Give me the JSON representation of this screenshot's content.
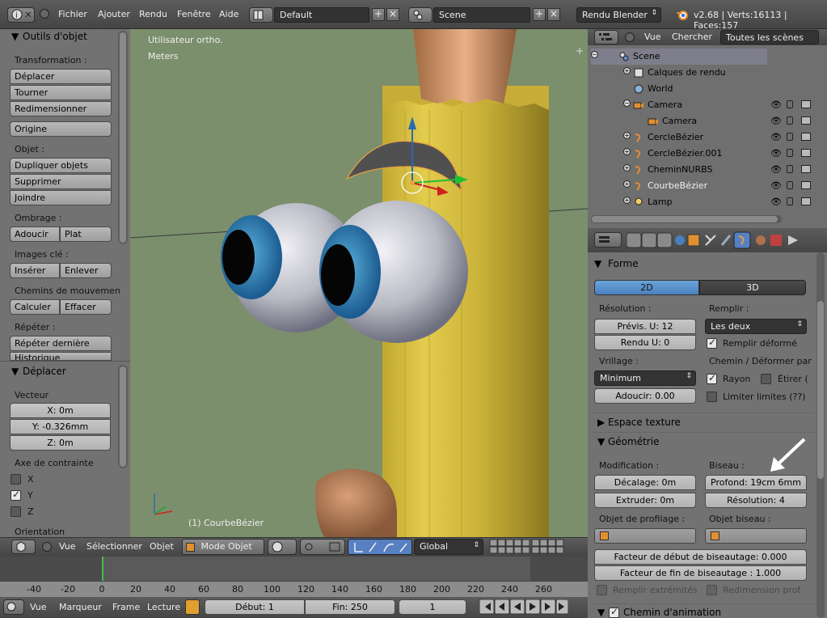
{
  "topbar": {
    "menus": [
      "Fichier",
      "Ajouter",
      "Rendu",
      "Fenêtre",
      "Aide"
    ],
    "layout": "Default",
    "scene": "Scene",
    "engine": "Rendu Blender",
    "stats": "v2.68 | Verts:16113 | Faces:157"
  },
  "toolshelf": {
    "title": "Outils d'objet",
    "transform_label": "Transformation :",
    "move": "Déplacer",
    "rotate": "Tourner",
    "scale": "Redimensionner",
    "origin": "Origine",
    "object_label": "Objet :",
    "duplicate": "Dupliquer objets",
    "delete": "Supprimer",
    "join": "Joindre",
    "shading_label": "Ombrage :",
    "smooth": "Adoucir",
    "flat": "Plat",
    "keyframes_label": "Images clé :",
    "insert": "Insérer",
    "remove": "Enlever",
    "motion_label": "Chemins de mouvemen",
    "calculate": "Calculer",
    "clear": "Effacer",
    "repeat_label": "Répéter :",
    "repeat_last": "Répéter dernière",
    "history": "Historique"
  },
  "operator": {
    "title": "Déplacer",
    "vector_label": "Vecteur",
    "x": "X: 0m",
    "y": "Y: -0.326mm",
    "z": "Z: 0m",
    "constraint_label": "Axe de contrainte",
    "axis_x": "X",
    "axis_y": "Y",
    "axis_z": "Z",
    "orientation": "Orientation"
  },
  "viewport": {
    "view_name": "Utilisateur ortho.",
    "units": "Meters",
    "object_label": "(1) CourbeBézier"
  },
  "viewport_header": {
    "view": "Vue",
    "select": "Sélectionner",
    "object": "Objet",
    "mode": "Mode Objet",
    "orientation": "Global"
  },
  "outliner": {
    "view": "Vue",
    "search": "Chercher",
    "filter": "Toutes les scènes",
    "items": [
      {
        "label": "Scene",
        "indent": 0
      },
      {
        "label": "Calques de rendu",
        "indent": 1
      },
      {
        "label": "World",
        "indent": 1
      },
      {
        "label": "Camera",
        "indent": 1
      },
      {
        "label": "Camera",
        "indent": 2
      },
      {
        "label": "CercleBézier",
        "indent": 1
      },
      {
        "label": "CercleBézier.001",
        "indent": 1
      },
      {
        "label": "CheminNURBS",
        "indent": 1
      },
      {
        "label": "CourbeBézier",
        "indent": 1
      },
      {
        "label": "Lamp",
        "indent": 1
      }
    ]
  },
  "properties": {
    "shape_header": "Forme",
    "tab_2d": "2D",
    "tab_3d": "3D",
    "resolution_label": "Résolution :",
    "preview_u": "Prévis. U: 12",
    "render_u": "Rendu U: 0",
    "fill_label": "Remplir :",
    "fill_value": "Les deux",
    "fill_deformed": "Remplir déformé",
    "twist_label": "Vrillage :",
    "twist_value": "Minimum",
    "smooth_value": "Adoucir: 0.00",
    "path_label": "Chemin / Déformer par",
    "radius": "Rayon",
    "stretch": "Étirer (",
    "bounds": "Limiter limites (??)",
    "texture_space": "Espace texture",
    "geometry_header": "Géométrie",
    "modification_label": "Modification :",
    "offset": "Décalage: 0m",
    "extrude": "Extruder: 0m",
    "bevel_label": "Biseau :",
    "depth": "Profond: 19cm 6mm",
    "bevel_res": "Résolution: 4",
    "taper_label": "Objet de profilage :",
    "bevel_obj_label": "Objet biseau :",
    "bevel_start": "Facteur de début de biseautage: 0.000",
    "bevel_end": "Facteur de fin de biseautage : 1.000",
    "fill_caps": "Remplir extrémités",
    "map_taper": "Redimension prof",
    "path_anim": "Chemin d'animation"
  },
  "timeline": {
    "ticks": [
      "-40",
      "-20",
      "0",
      "20",
      "40",
      "60",
      "80",
      "100",
      "120",
      "140",
      "160",
      "180",
      "200",
      "220",
      "240",
      "260"
    ],
    "view": "Vue",
    "marker": "Marqueur",
    "frame": "Frame",
    "playback": "Lecture",
    "start": "Début: 1",
    "end": "Fin: 250",
    "current": "1"
  }
}
